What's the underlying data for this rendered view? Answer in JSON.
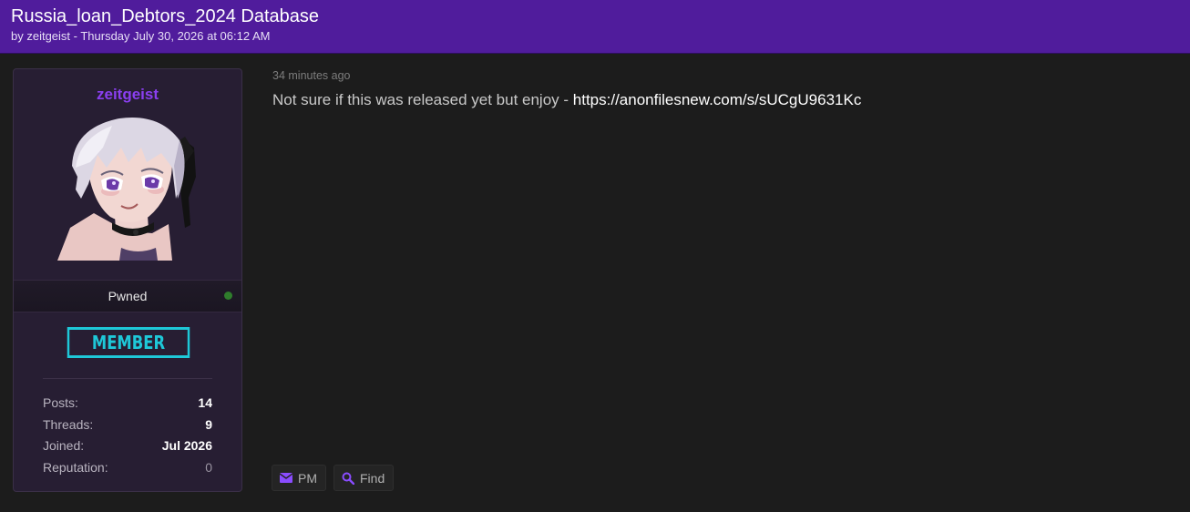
{
  "thread": {
    "title": "Russia_loan_Debtors_2024 Database",
    "meta": "by zeitgeist - Thursday July 30, 2026 at 06:12 AM"
  },
  "user": {
    "name": "zeitgeist",
    "title": "Pwned",
    "rank_badge": "MEMBER",
    "stats": [
      {
        "label": "Posts:",
        "value": "14"
      },
      {
        "label": "Threads:",
        "value": "9"
      },
      {
        "label": "Joined:",
        "value": "Jul 2026"
      },
      {
        "label": "Reputation:",
        "value": "0"
      }
    ]
  },
  "post": {
    "time": "34 minutes ago",
    "text": "Not sure if this was released yet but enjoy - ",
    "link": "https://anonfilesnew.com/s/sUCgU9631Kc"
  },
  "actions": {
    "pm_label": "PM",
    "find_label": "Find"
  },
  "icons": {
    "pm": "envelope-icon",
    "find": "search-icon",
    "online": "online-status-icon"
  },
  "colors": {
    "header_bg": "#501c9c",
    "username": "#8a3ff0",
    "rank_badge": "#1ec8d8",
    "online": "#2f7d2c",
    "icon_accent": "#8a4cff"
  }
}
